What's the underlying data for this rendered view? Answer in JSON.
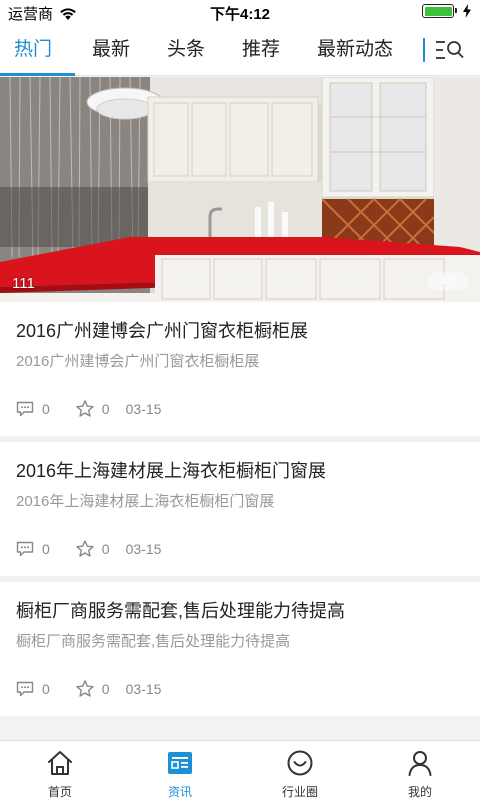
{
  "status": {
    "carrier": "运营商",
    "time": "下午4:12",
    "battery_level": 1.0
  },
  "tabs": [
    {
      "label": "热门",
      "active": true
    },
    {
      "label": "最新",
      "active": false
    },
    {
      "label": "头条",
      "active": false
    },
    {
      "label": "推荐",
      "active": false
    },
    {
      "label": "最新动态",
      "active": false
    }
  ],
  "banner": {
    "caption": "111",
    "pager": "1/3"
  },
  "articles": [
    {
      "title": "2016广州建博会广州门窗衣柜橱柜展",
      "summary": "2016广州建博会广州门窗衣柜橱柜展",
      "comments": "0",
      "favorites": "0",
      "date": "03-15"
    },
    {
      "title": "2016年上海建材展上海衣柜橱柜门窗展",
      "summary": "2016年上海建材展上海衣柜橱柜门窗展",
      "comments": "0",
      "favorites": "0",
      "date": "03-15"
    },
    {
      "title": "橱柜厂商服务需配套,售后处理能力待提高",
      "summary": "橱柜厂商服务需配套,售后处理能力待提高",
      "comments": "0",
      "favorites": "0",
      "date": "03-15"
    }
  ],
  "bottom_nav": [
    {
      "label": "首页",
      "icon": "home-icon",
      "active": false
    },
    {
      "label": "资讯",
      "icon": "news-icon",
      "active": true
    },
    {
      "label": "行业圈",
      "icon": "circle-smile-icon",
      "active": false
    },
    {
      "label": "我的",
      "icon": "person-icon",
      "active": false
    }
  ],
  "colors": {
    "accent": "#1e8fd4",
    "counter_red": "#d9141c"
  }
}
